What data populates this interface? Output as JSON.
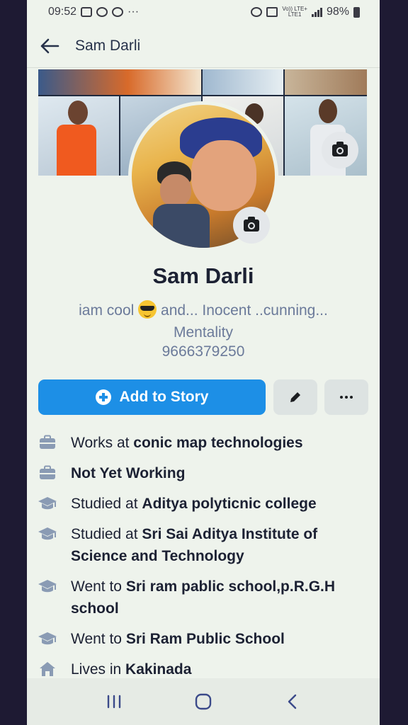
{
  "status_bar": {
    "time": "09:52",
    "more": "···",
    "net": "Vo)) LTE+",
    "net2": "LTE1",
    "battery": "98%"
  },
  "app_bar": {
    "back_icon": "back-arrow-icon",
    "title": "Sam Darli"
  },
  "profile": {
    "name": "Sam Darli",
    "bio_part1": "iam cool",
    "bio_emoji": "sunglasses-emoji",
    "bio_part2": "and... Inocent ..cunning... Mentality",
    "phone": "9666379250"
  },
  "actions": {
    "add_story_label": "Add to Story",
    "edit_icon": "pencil-icon",
    "more_icon": "more-dots-icon"
  },
  "details": [
    {
      "icon": "briefcase-icon",
      "prefix": "Works at ",
      "bold": "conic map technologies"
    },
    {
      "icon": "briefcase-icon",
      "prefix": "",
      "bold": "Not Yet Working"
    },
    {
      "icon": "graduation-cap-icon",
      "prefix": "Studied at ",
      "bold": "Aditya polyticnic college"
    },
    {
      "icon": "graduation-cap-icon",
      "prefix": "Studied at ",
      "bold": "Sri Sai Aditya Institute of Science and Technology"
    },
    {
      "icon": "graduation-cap-icon",
      "prefix": "Went to ",
      "bold": "Sri ram pablic school,p.R.G.H school"
    },
    {
      "icon": "graduation-cap-icon",
      "prefix": "Went to ",
      "bold": "Sri Ram Public School"
    },
    {
      "icon": "home-icon",
      "prefix": "Lives in ",
      "bold": "Kakinada"
    }
  ],
  "colors": {
    "accent": "#1d8fe6",
    "background": "#eef3ec",
    "text": "#1c2133",
    "muted": "#6b7a9a"
  }
}
